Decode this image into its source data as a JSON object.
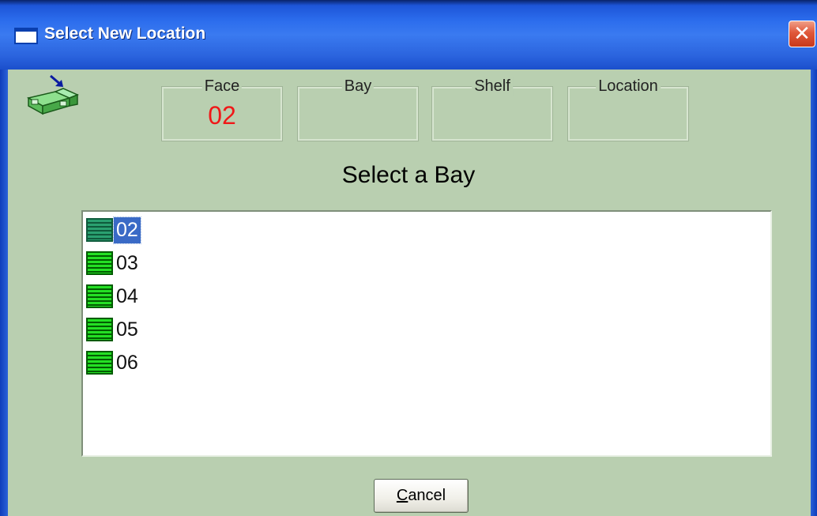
{
  "window": {
    "title": "Select New Location",
    "close_label": "✕"
  },
  "header": {
    "icon": "shelf-location-icon",
    "groups": [
      {
        "legend": "Face",
        "value": "02"
      },
      {
        "legend": "Bay",
        "value": ""
      },
      {
        "legend": "Shelf",
        "value": ""
      },
      {
        "legend": "Location",
        "value": ""
      }
    ]
  },
  "main": {
    "heading": "Select a Bay",
    "selected_index": 0,
    "bays": [
      {
        "label": "02",
        "icon": "bay-icon"
      },
      {
        "label": "03",
        "icon": "bay-icon"
      },
      {
        "label": "04",
        "icon": "bay-icon"
      },
      {
        "label": "05",
        "icon": "bay-icon"
      },
      {
        "label": "06",
        "icon": "bay-icon"
      }
    ]
  },
  "footer": {
    "cancel_mnemonic": "C",
    "cancel_rest": "ancel"
  },
  "colors": {
    "background": "#b9cfb0",
    "title_bar": "#2c6ded",
    "face_value": "#f01818",
    "selection": "#3a6ac6"
  }
}
